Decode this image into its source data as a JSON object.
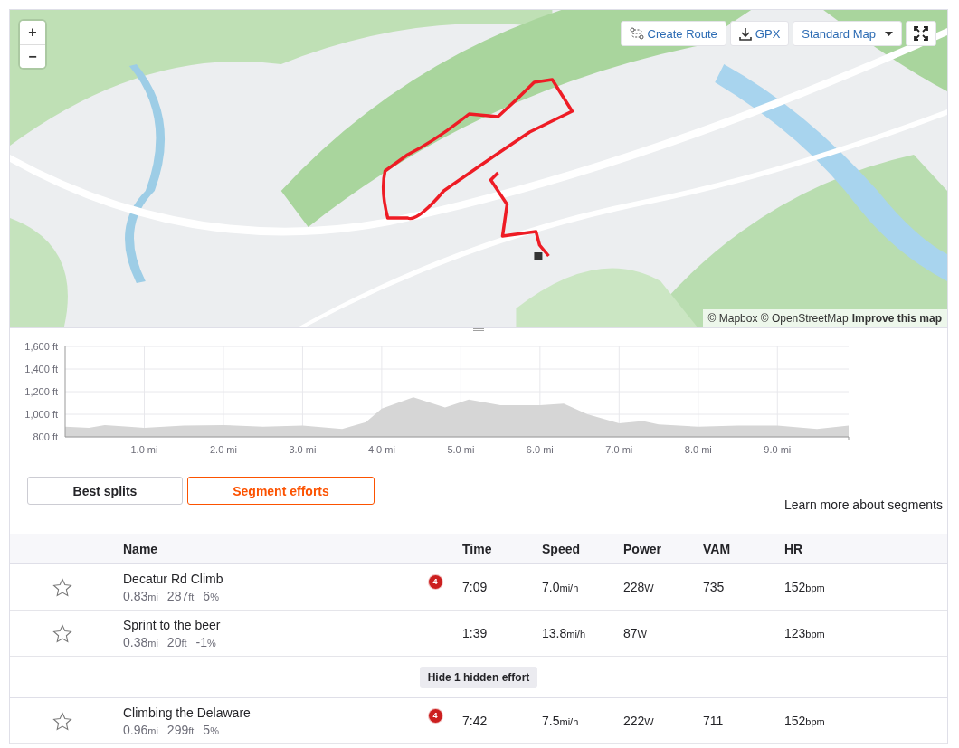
{
  "map": {
    "zoom_in": "+",
    "zoom_out": "−",
    "buttons": [
      {
        "kind": "route",
        "label": "Create Route"
      },
      {
        "kind": "download",
        "label": "GPX"
      },
      {
        "kind": "dropdown",
        "label": "Standard Map"
      },
      {
        "kind": "fullscreen"
      }
    ],
    "attribution": {
      "text": "© Mapbox © OpenStreetMap",
      "link": "Improve this map"
    }
  },
  "elevation": {
    "chart_data": {
      "type": "area",
      "grid": true,
      "x": [
        0,
        0.3,
        0.5,
        0.8,
        1.0,
        1.5,
        2.0,
        2.5,
        3.0,
        3.5,
        3.8,
        4.0,
        4.4,
        4.8,
        5.1,
        5.5,
        6.0,
        6.3,
        6.6,
        7.0,
        7.3,
        7.5,
        8.0,
        8.5,
        9.0,
        9.5,
        9.9
      ],
      "values": [
        890,
        880,
        905,
        890,
        880,
        900,
        905,
        890,
        900,
        870,
        930,
        1050,
        1150,
        1060,
        1130,
        1080,
        1080,
        1095,
        1000,
        920,
        940,
        910,
        890,
        900,
        900,
        870,
        900
      ],
      "xlim": [
        0,
        9.9
      ],
      "ylim": [
        800,
        1600
      ],
      "xticks": [
        {
          "value": 1,
          "label": "1.0 mi"
        },
        {
          "value": 2,
          "label": "2.0 mi"
        },
        {
          "value": 3,
          "label": "3.0 mi"
        },
        {
          "value": 4,
          "label": "4.0 mi"
        },
        {
          "value": 5,
          "label": "5.0 mi"
        },
        {
          "value": 6,
          "label": "6.0 mi"
        },
        {
          "value": 7,
          "label": "7.0 mi"
        },
        {
          "value": 8,
          "label": "8.0 mi"
        },
        {
          "value": 9,
          "label": "9.0 mi"
        }
      ],
      "yticks": [
        {
          "value": 800,
          "label": "800 ft"
        },
        {
          "value": 1000,
          "label": "1,000 ft"
        },
        {
          "value": 1200,
          "label": "1,200 ft"
        },
        {
          "value": 1400,
          "label": "1,400 ft"
        },
        {
          "value": 1600,
          "label": "1,600 ft"
        }
      ]
    }
  },
  "tabs": [
    {
      "label": "Best splits",
      "selected": false
    },
    {
      "label": "Segment efforts",
      "selected": true
    }
  ],
  "learn_more": "Learn more about segments",
  "segments": {
    "columns": [
      "Name",
      "Time",
      "Speed",
      "Power",
      "VAM",
      "HR"
    ],
    "rows": [
      {
        "kind": "effort",
        "starred": false,
        "name": "Decatur Rd Climb",
        "stats": [
          {
            "value": "0.83",
            "unit": "mi"
          },
          {
            "value": "287",
            "unit": "ft"
          },
          {
            "value": "6",
            "unit": "%"
          }
        ],
        "rank": "4",
        "time": "7:09",
        "speed": {
          "value": "7.0",
          "unit": "mi/h"
        },
        "power": {
          "value": "228",
          "unit": "W"
        },
        "vam": "735",
        "hr": {
          "value": "152",
          "unit": "bpm"
        }
      },
      {
        "kind": "effort",
        "starred": false,
        "name": "Sprint to the beer",
        "stats": [
          {
            "value": "0.38",
            "unit": "mi"
          },
          {
            "value": "20",
            "unit": "ft"
          },
          {
            "value": "-1",
            "unit": "%"
          }
        ],
        "time": "1:39",
        "speed": {
          "value": "13.8",
          "unit": "mi/h"
        },
        "power": {
          "value": "87",
          "unit": "W"
        },
        "hr": {
          "value": "123",
          "unit": "bpm"
        }
      },
      {
        "kind": "toggle",
        "label": "Hide 1 hidden effort"
      },
      {
        "kind": "effort",
        "starred": false,
        "name": "Climbing the Delaware",
        "stats": [
          {
            "value": "0.96",
            "unit": "mi"
          },
          {
            "value": "299",
            "unit": "ft"
          },
          {
            "value": "5",
            "unit": "%"
          }
        ],
        "rank": "4",
        "time": "7:42",
        "speed": {
          "value": "7.5",
          "unit": "mi/h"
        },
        "power": {
          "value": "222",
          "unit": "W"
        },
        "vam": "711",
        "hr": {
          "value": "152",
          "unit": "bpm"
        }
      }
    ]
  }
}
